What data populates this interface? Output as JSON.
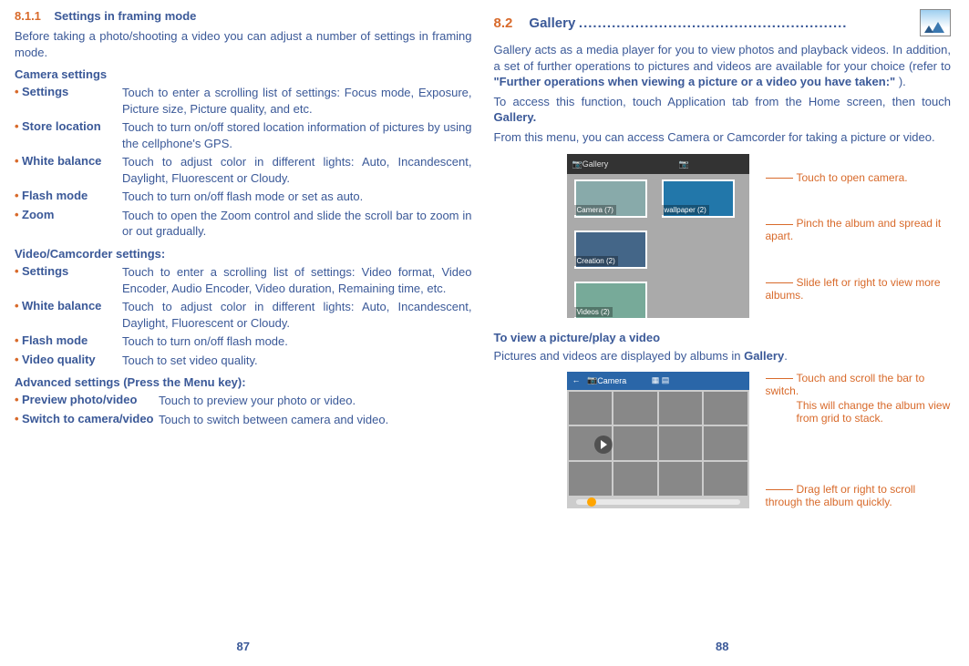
{
  "left": {
    "sec_num": "8.1.1",
    "sec_title": "Settings in framing mode",
    "intro": "Before taking a photo/shooting a video you can adjust a number of settings in framing mode.",
    "camera_h": "Camera settings",
    "camera": [
      {
        "term": "Settings",
        "desc": "Touch to enter a scrolling list of settings: Focus mode, Exposure, Picture size, Picture quality, and etc."
      },
      {
        "term": "Store location",
        "desc": "Touch to turn on/off stored location information of pictures by using the cellphone's GPS."
      },
      {
        "term": "White balance",
        "desc": "Touch to adjust color in different lights: Auto, Incandescent, Daylight, Fluorescent or Cloudy."
      },
      {
        "term": "Flash mode",
        "desc": "Touch to turn on/off flash mode or set as auto."
      },
      {
        "term": "Zoom",
        "desc": "Touch to open the Zoom control and slide the scroll bar to zoom in or out gradually."
      }
    ],
    "video_h": "Video/Camcorder settings:",
    "video": [
      {
        "term": "Settings",
        "desc": "Touch to enter a scrolling list of settings:  Video format, Video Encoder, Audio Encoder, Video duration, Remaining time, etc."
      },
      {
        "term": "White balance",
        "desc": "Touch to adjust color in different lights: Auto, Incandescent, Daylight, Fluorescent or Cloudy."
      },
      {
        "term": "Flash mode",
        "desc": "Touch to turn on/off flash mode."
      },
      {
        "term": "Video quality",
        "desc": "Touch to set video quality."
      }
    ],
    "adv_h": "Advanced settings (Press the Menu key):",
    "adv": [
      {
        "term": "Preview photo/video",
        "desc": "Touch to preview your photo or video."
      },
      {
        "term": "Switch to camera/video",
        "desc": "Touch to switch between camera and video."
      }
    ],
    "pageno": "87"
  },
  "right": {
    "sec_num": "8.2",
    "sec_title": "Gallery",
    "dots": ".........................................................",
    "p1a": "Gallery acts as a media player for you to view photos and playback videos. In addition, a set of further operations to pictures and videos are available for your choice (refer to ",
    "p1b": "\"Further operations when viewing a picture or a video you have taken:\"",
    "p1c": " ).",
    "p2a": "To access this function, touch Application tab from the Home screen, then touch ",
    "p2b": "Gallery.",
    "p3": "From this menu, you can access Camera or Camcorder for taking a picture or video.",
    "fig1": {
      "topbar": "Gallery",
      "labels": {
        "a": "Camera (7)",
        "b": "wallpaper (2)",
        "c": "Creation (2)",
        "d": "Videos (2)"
      },
      "callouts": [
        "Touch to open camera.",
        "Pinch the album and spread it apart.",
        "Slide left or right to view more albums."
      ]
    },
    "sub_h": "To view a picture/play a video",
    "p4a": "Pictures and videos are displayed by albums in ",
    "p4b": "Gallery",
    "p4c": ".",
    "fig2": {
      "topbar": "Camera",
      "callouts_top": [
        "Touch and scroll the bar to switch.",
        "This will change the album view from grid to stack."
      ],
      "callouts_bottom": "Drag left or right to scroll through the album quickly."
    },
    "pageno": "88"
  }
}
